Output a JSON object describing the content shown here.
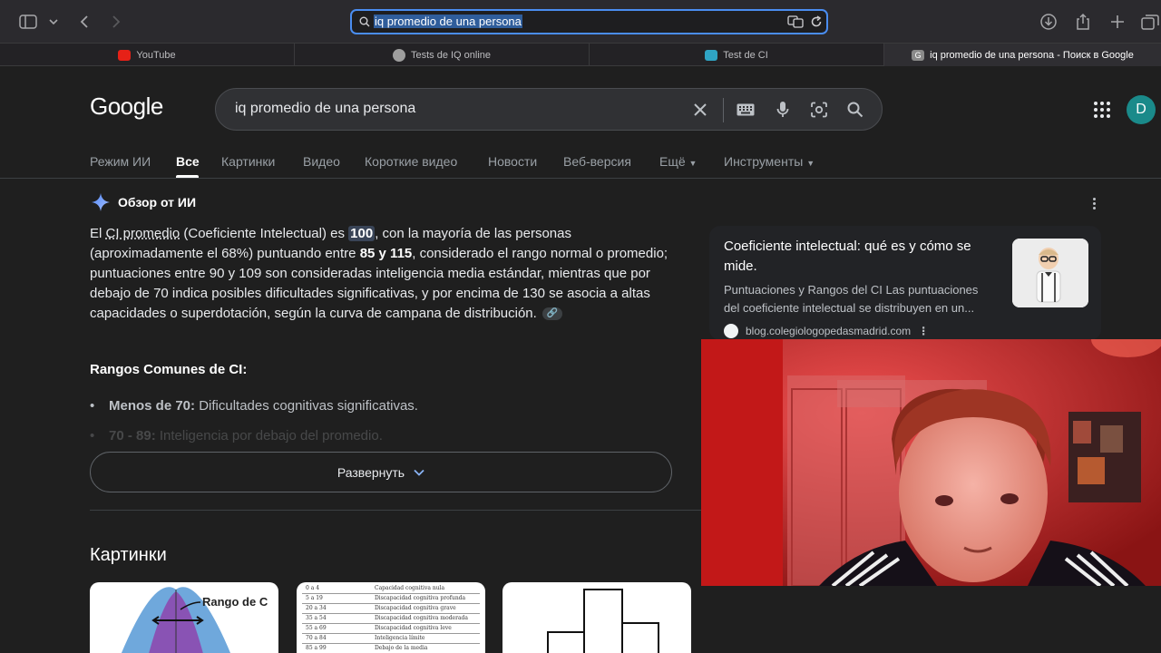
{
  "browser": {
    "url_text": "iq promedio de una persona",
    "tabs": [
      {
        "label": "YouTube",
        "color": "#e62117"
      },
      {
        "label": "Tests de IQ online",
        "color": "#9e9e9e"
      },
      {
        "label": "Test de CI",
        "color": "#2fa4c4"
      },
      {
        "label": "iq promedio de una persona - Поиск в Google",
        "color": "#8a8a8a"
      }
    ]
  },
  "google": {
    "logo": "Google",
    "query": "iq promedio de una persona",
    "avatar_letter": "D",
    "nav": [
      "Режим ИИ",
      "Все",
      "Картинки",
      "Видео",
      "Короткие видео",
      "Новости",
      "Веб-версия",
      "Ещё",
      "Инструменты"
    ]
  },
  "ai_overview": {
    "title": "Обзор от ИИ",
    "p1": "El ",
    "p_ci": "CI promedio",
    "p2": " (Coeficiente Intelectual) es ",
    "p_100": "100",
    "p3": ", con la mayoría de las personas (aproximadamente el 68%) puntuando entre ",
    "p_range": "85 y 115",
    "p4": ", considerado el rango normal o promedio; puntuaciones entre 90 y 109 son consideradas inteligencia media estándar, mientras que por debajo de 70 indica posibles dificultades significativas, y por encima de 130 se asocia a altas capacidades o superdotación, según la curva de campana de distribución.",
    "ranges_title": "Rangos Comunes de CI:",
    "bullet1_key": "Menos de 70:",
    "bullet1_val": " Dificultades cognitivas significativas.",
    "bullet2_key": "70 - 89:",
    "bullet2_val": " Inteligencia por debajo del promedio.",
    "expand_label": "Развернуть"
  },
  "source_card": {
    "title": "Coeficiente intelectual: qué es y cómo se mide.",
    "snippet_1": "Puntuaciones y Rangos del CI Las puntuaciones",
    "snippet_2": "del coeficiente intelectual se distribuyen en un...",
    "domain": "blog.colegiologopedasmadrid.com"
  },
  "images": {
    "title": "Картинки",
    "thumb1_label": "Rango de C",
    "table_rows": [
      [
        "0 a 4",
        "Capacidad cognitiva nula"
      ],
      [
        "5 a 19",
        "Discapacidad cognitiva profunda"
      ],
      [
        "20 a 34",
        "Discapacidad cognitiva grave"
      ],
      [
        "35 a 54",
        "Discapacidad cognitiva moderada"
      ],
      [
        "55 a 69",
        "Discapacidad cognitiva leve"
      ],
      [
        "70 a 84",
        "Inteligencia límite"
      ],
      [
        "85 a 99",
        "Debajo de la media"
      ]
    ]
  }
}
